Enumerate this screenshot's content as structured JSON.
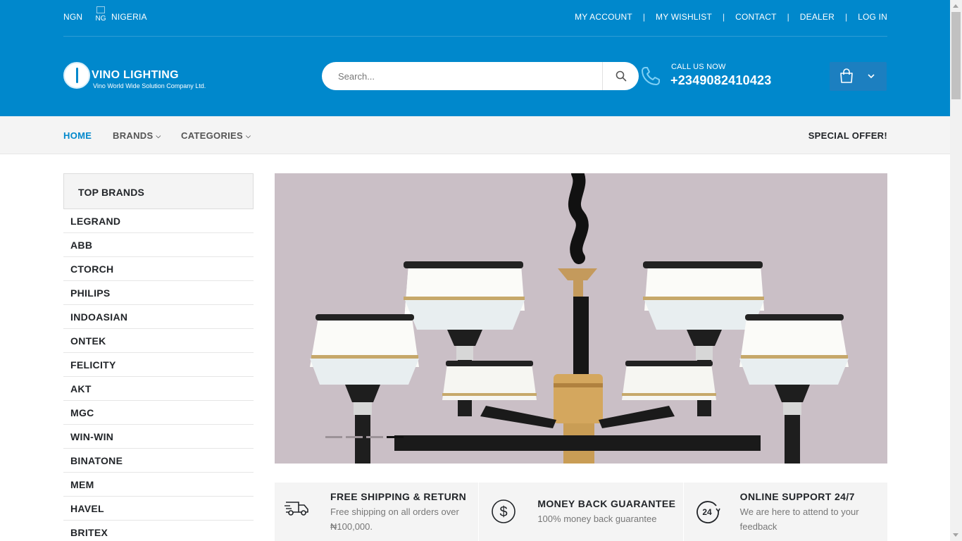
{
  "topbar": {
    "currency": "NGN",
    "flag_alt": "NG",
    "country": "NIGERIA",
    "links": [
      "MY ACCOUNT",
      "MY WISHLIST",
      "CONTACT",
      "DEALER",
      "LOG IN"
    ]
  },
  "logo": {
    "name": "VINO LIGHTING",
    "tagline": "Vino World Wide Solution Company Ltd."
  },
  "search": {
    "placeholder": "Search..."
  },
  "call": {
    "label": "CALL US NOW",
    "number": "+2349082410423"
  },
  "nav": {
    "items": [
      {
        "label": "HOME",
        "active": true,
        "dropdown": false
      },
      {
        "label": "BRANDS",
        "active": false,
        "dropdown": true
      },
      {
        "label": "CATEGORIES",
        "active": false,
        "dropdown": true
      }
    ],
    "special": "SPECIAL OFFER!"
  },
  "sidebar": {
    "title": "TOP BRANDS",
    "brands": [
      "LEGRAND",
      "ABB",
      "CTORCH",
      "PHILIPS",
      "INDOASIAN",
      "ONTEK",
      "FELICITY",
      "AKT",
      "MGC",
      "WIN-WIN",
      "BINATONE",
      "MEM",
      "HAVEL",
      "BRITEX"
    ]
  },
  "slider": {
    "slides": 4,
    "active_index": 3
  },
  "features": [
    {
      "icon": "truck-icon",
      "title": "FREE SHIPPING & RETURN",
      "desc": "Free shipping on all orders over ₦100,000."
    },
    {
      "icon": "dollar-icon",
      "title": "MONEY BACK GUARANTEE",
      "desc": "100% money back guarantee"
    },
    {
      "icon": "support-24-icon",
      "title": "ONLINE SUPPORT 24/7",
      "desc": "We are here to attend to your feedback"
    }
  ],
  "colors": {
    "primary": "#0088cc",
    "nav_bg": "#f4f4f4",
    "text_dark": "#222529",
    "text_muted": "#777777"
  }
}
